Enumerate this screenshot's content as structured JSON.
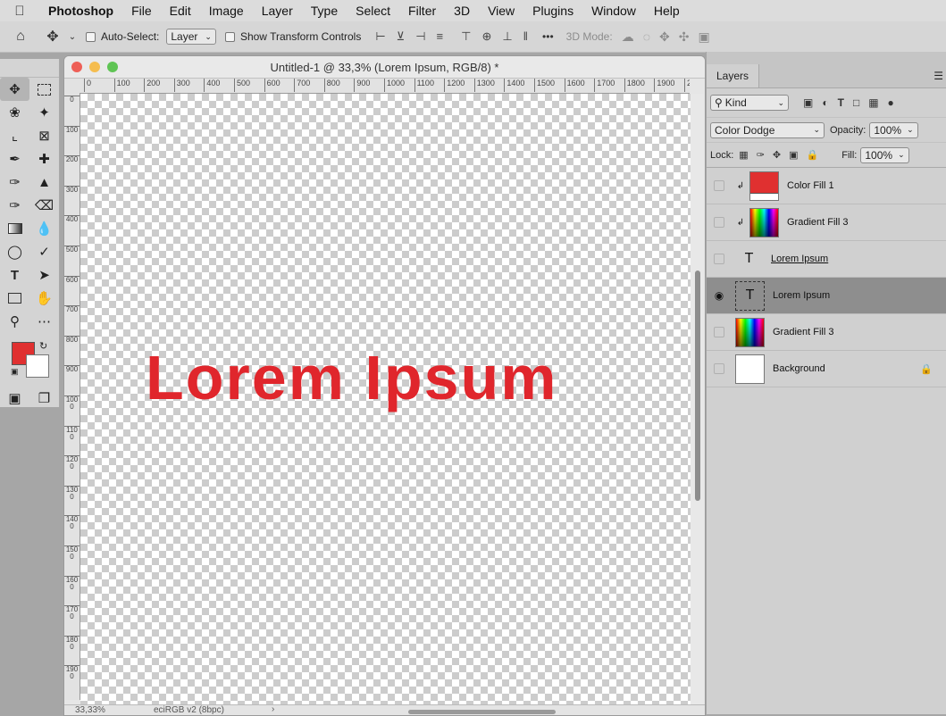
{
  "menubar": {
    "apple_icon": "apple-icon",
    "items": [
      "Photoshop",
      "File",
      "Edit",
      "Image",
      "Layer",
      "Type",
      "Select",
      "Filter",
      "3D",
      "View",
      "Plugins",
      "Window",
      "Help"
    ]
  },
  "options": {
    "auto_select_label": "Auto-Select:",
    "auto_select_value": "Layer",
    "show_transform_label": "Show Transform Controls",
    "more_label": "•••",
    "mode_3d_label": "3D Mode:"
  },
  "document": {
    "title": "Untitled-1 @ 33,3% (Lorem Ipsum, RGB/8) *",
    "canvas_text": "Lorem Ipsum",
    "ruler_h": [
      "0",
      "100",
      "200",
      "300",
      "400",
      "500",
      "600",
      "700",
      "800",
      "900",
      "1000",
      "1100",
      "1200",
      "1300",
      "1400",
      "1500",
      "1600",
      "1700",
      "1800",
      "1900",
      "200"
    ],
    "ruler_v": [
      "0",
      "100",
      "200",
      "300",
      "400",
      "500",
      "600",
      "700",
      "800",
      "900",
      "1000",
      "1100",
      "1200",
      "1300",
      "1400",
      "1500",
      "1600",
      "1700",
      "1800",
      "1900"
    ],
    "zoom": "33,33%",
    "color_profile": "eciRGB v2 (8bpc)"
  },
  "colors": {
    "foreground": "#e03030",
    "background": "#ffffff",
    "text_color": "#e0262c"
  },
  "layers_panel": {
    "tab_label": "Layers",
    "filter_value": "Kind",
    "blend_mode": "Color Dodge",
    "opacity_label": "Opacity:",
    "opacity_value": "100%",
    "lock_label": "Lock:",
    "fill_label": "Fill:",
    "fill_value": "100%",
    "layers": [
      {
        "name": "Color Fill 1",
        "type": "color-fill",
        "clipped": true,
        "visible": false,
        "selected": false
      },
      {
        "name": "Gradient Fill 3",
        "type": "gradient",
        "clipped": true,
        "visible": false,
        "selected": false
      },
      {
        "name": "Lorem Ipsum",
        "type": "text",
        "clipped": false,
        "visible": false,
        "selected": false
      },
      {
        "name": "Lorem Ipsum",
        "type": "text",
        "clipped": false,
        "visible": true,
        "selected": true
      },
      {
        "name": "Gradient Fill 3",
        "type": "gradient",
        "clipped": false,
        "visible": false,
        "selected": false
      },
      {
        "name": "Background",
        "type": "background",
        "clipped": false,
        "visible": false,
        "selected": false,
        "locked": true
      }
    ]
  }
}
